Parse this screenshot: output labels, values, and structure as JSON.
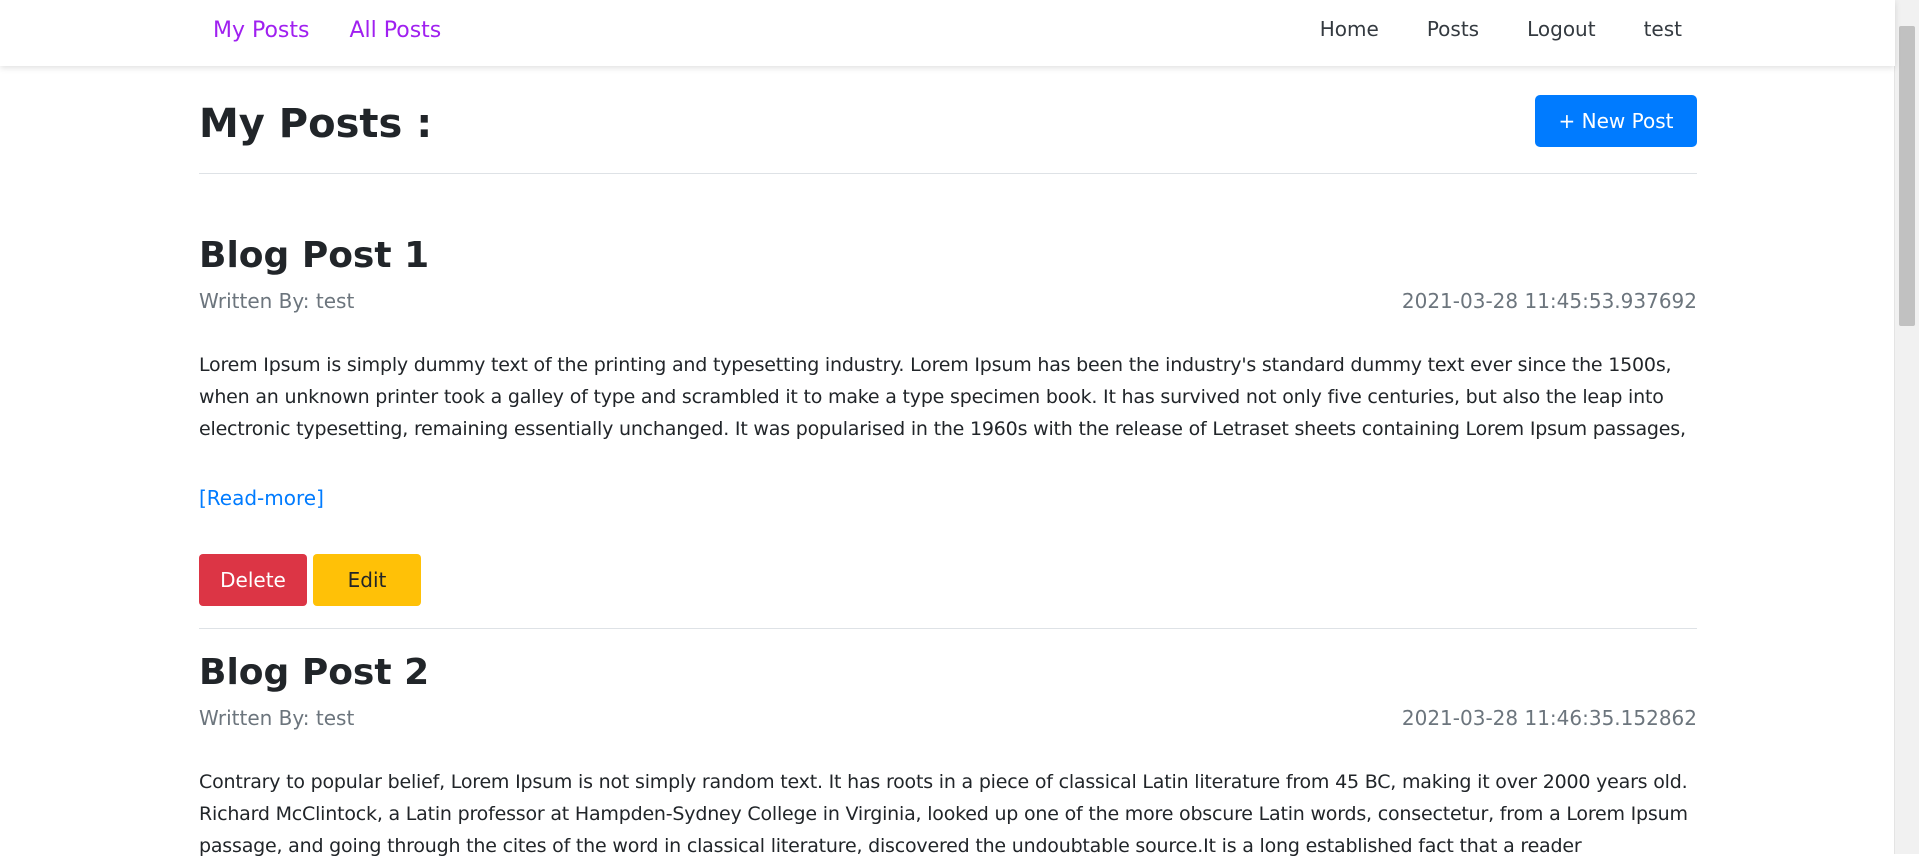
{
  "navbar": {
    "left_links": [
      "My Posts",
      "All Posts"
    ],
    "right_links": [
      "Home",
      "Posts",
      "Logout",
      "test"
    ]
  },
  "page": {
    "title": "My Posts :",
    "new_post_label": "+ New Post"
  },
  "posts": [
    {
      "title": "Blog Post 1",
      "author": "Written By: test",
      "date": "2021-03-28 11:45:53.937692",
      "body": "Lorem Ipsum is simply dummy text of the printing and typesetting industry. Lorem Ipsum has been the industry's standard dummy text ever since the 1500s, when an unknown printer took a galley of type and scrambled it to make a type specimen book. It has survived not only five centuries, but also the leap into electronic typesetting, remaining essentially unchanged. It was popularised in the 1960s with the release of Letraset sheets containing Lorem Ipsum passages,",
      "read_more": "[Read-more]",
      "delete_label": "Delete",
      "edit_label": "Edit"
    },
    {
      "title": "Blog Post 2",
      "author": "Written By: test",
      "date": "2021-03-28 11:46:35.152862",
      "body": "Contrary to popular belief, Lorem Ipsum is not simply random text. It has roots in a piece of classical Latin literature from 45 BC, making it over 2000 years old. Richard McClintock, a Latin professor at Hampden-Sydney College in Virginia, looked up one of the more obscure Latin words, consectetur, from a Lorem Ipsum passage, and going through the cites of the word in classical literature, discovered the undoubtable source.It is a long established fact that a reader"
    }
  ],
  "colors": {
    "nav_link": "#a020f0",
    "primary": "#007bff",
    "danger": "#dc3545",
    "warning": "#ffc107",
    "muted": "#6c757d"
  }
}
